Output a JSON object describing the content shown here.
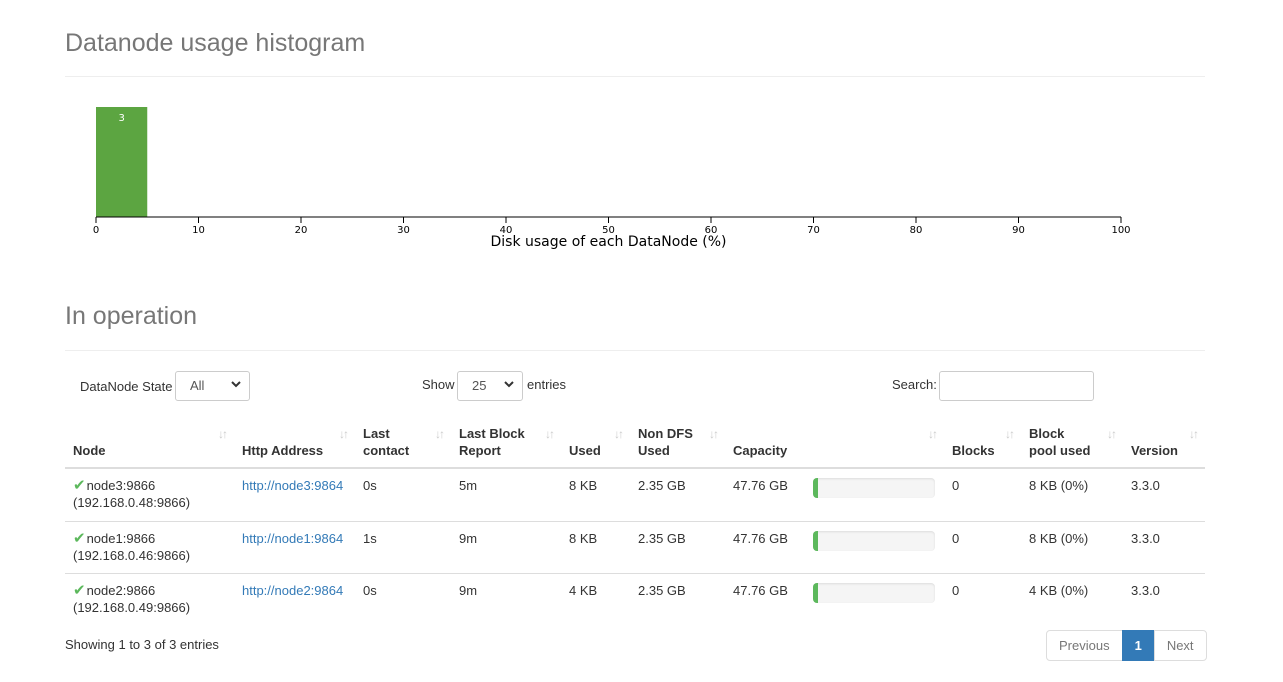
{
  "histogram_section": {
    "title": "Datanode usage histogram"
  },
  "chart_data": {
    "type": "bar",
    "title": "",
    "xlabel": "Disk usage of each DataNode (%)",
    "ylabel": "",
    "xlim": [
      0,
      100
    ],
    "x_ticks": [
      "0",
      "10",
      "20",
      "30",
      "40",
      "50",
      "60",
      "70",
      "80",
      "90",
      "100"
    ],
    "bins": [
      {
        "x0": 0,
        "x1": 5,
        "count": 3,
        "label": "3"
      }
    ],
    "bar_color": "#5ca541",
    "grid": false
  },
  "operation_section": {
    "title": "In operation"
  },
  "controls": {
    "state_label": "DataNode State",
    "state_value": "All",
    "show_label": "Show",
    "entries_value": "25",
    "entries_label": "entries",
    "search_label": "Search:",
    "search_value": ""
  },
  "table": {
    "columns": [
      {
        "line1": "",
        "line2": "Node"
      },
      {
        "line1": "",
        "line2": "Http Address"
      },
      {
        "line1": "Last",
        "line2": "contact"
      },
      {
        "line1": "Last Block",
        "line2": "Report"
      },
      {
        "line1": "",
        "line2": "Used"
      },
      {
        "line1": "Non DFS",
        "line2": "Used"
      },
      {
        "line1": "",
        "line2": "Capacity"
      },
      {
        "line1": "",
        "line2": "Blocks"
      },
      {
        "line1": "Block",
        "line2": "pool used"
      },
      {
        "line1": "",
        "line2": "Version"
      }
    ],
    "sort_icon": "sort-both-icon",
    "rows": [
      {
        "status_icon": "check-icon",
        "node": "node3:9866",
        "ip": "(192.168.0.48:9866)",
        "http": "http://node3:9864",
        "last_contact": "0s",
        "last_block_report": "5m",
        "used": "8 KB",
        "non_dfs_used": "2.35 GB",
        "capacity": "47.76 GB",
        "used_fraction": 0.04,
        "blocks": "0",
        "block_pool_used": "8 KB (0%)",
        "version": "3.3.0"
      },
      {
        "status_icon": "check-icon",
        "node": "node1:9866",
        "ip": "(192.168.0.46:9866)",
        "http": "http://node1:9864",
        "last_contact": "1s",
        "last_block_report": "9m",
        "used": "8 KB",
        "non_dfs_used": "2.35 GB",
        "capacity": "47.76 GB",
        "used_fraction": 0.04,
        "blocks": "0",
        "block_pool_used": "8 KB (0%)",
        "version": "3.3.0"
      },
      {
        "status_icon": "check-icon",
        "node": "node2:9866",
        "ip": "(192.168.0.49:9866)",
        "http": "http://node2:9864",
        "last_contact": "0s",
        "last_block_report": "9m",
        "used": "4 KB",
        "non_dfs_used": "2.35 GB",
        "capacity": "47.76 GB",
        "used_fraction": 0.04,
        "blocks": "0",
        "block_pool_used": "4 KB (0%)",
        "version": "3.3.0"
      }
    ]
  },
  "footer": {
    "info": "Showing 1 to 3 of 3 entries",
    "previous": "Previous",
    "page": "1",
    "next": "Next"
  },
  "colors": {
    "accent": "#337ab7",
    "success": "#5cb85c"
  }
}
